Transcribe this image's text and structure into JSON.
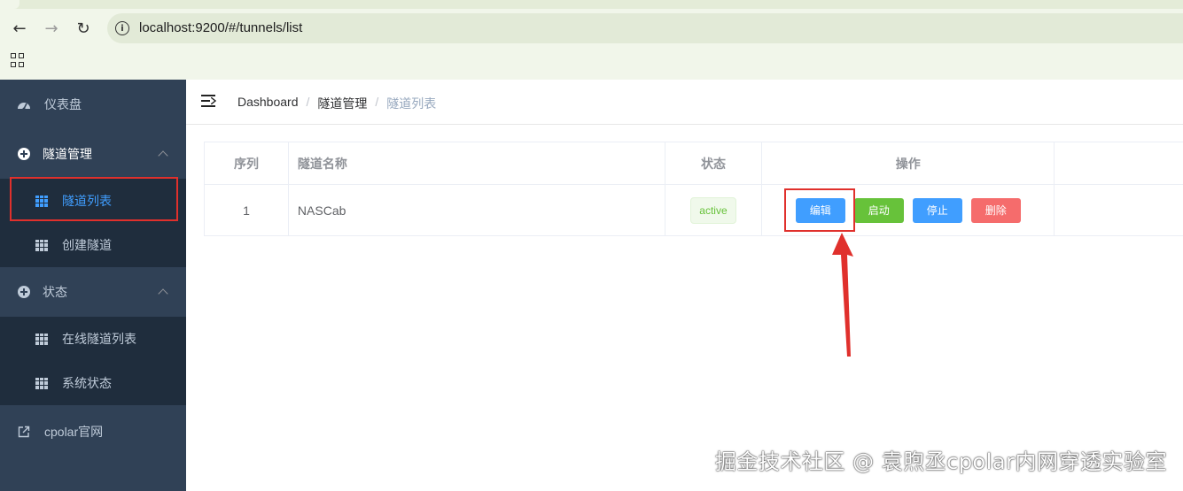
{
  "browser": {
    "url": "localhost:9200/#/tunnels/list"
  },
  "sidebar": {
    "dashboard": "仪表盘",
    "tunnel_management": "隧道管理",
    "tunnel_list": "隧道列表",
    "create_tunnel": "创建隧道",
    "status": "状态",
    "online_tunnel_list": "在线隧道列表",
    "system_status": "系统状态",
    "cpolar_site": "cpolar官网"
  },
  "breadcrumb": {
    "items": [
      "Dashboard",
      "隧道管理",
      "隧道列表"
    ],
    "separator": "/"
  },
  "table": {
    "headers": [
      "序列",
      "隧道名称",
      "状态",
      "操作"
    ],
    "rows": [
      {
        "index": "1",
        "name": "NASCab",
        "status": "active",
        "actions": [
          "编辑",
          "启动",
          "停止",
          "删除"
        ]
      }
    ]
  },
  "watermark": "掘金技术社区 @ 袁煦丞cpolar内网穿透实验室",
  "colors": {
    "sidebar_bg": "#304156",
    "submenu_bg": "#1f2d3d",
    "active": "#409eff",
    "success": "#67c23a",
    "danger": "#f56c6c",
    "annotation": "#e0302c"
  }
}
